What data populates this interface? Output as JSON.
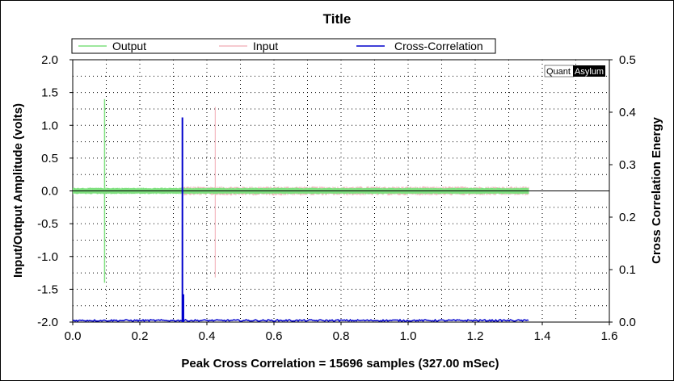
{
  "chart_data": {
    "type": "line",
    "title": "Title",
    "xlabel": "Peak Cross Correlation = 15696 samples  (327.00 mSec)",
    "ylabel": "Input/Output Amplitude (volts)",
    "y2label": "Cross Correlation Energy",
    "xlim": [
      0.0,
      1.6
    ],
    "ylim": [
      -2.0,
      2.0
    ],
    "y2lim": [
      0.0,
      0.5
    ],
    "x_ticks": [
      "0.0",
      "0.2",
      "0.4",
      "0.6",
      "0.8",
      "1.0",
      "1.2",
      "1.4",
      "1.6"
    ],
    "y_ticks": [
      "2.0",
      "1.5",
      "1.0",
      "0.5",
      "0.0",
      "-0.5",
      "-1.0",
      "-1.5",
      "-2.0"
    ],
    "y2_ticks": [
      "0.5",
      "0.4",
      "0.3",
      "0.2",
      "0.1",
      "0.0"
    ],
    "grid": true,
    "legend_position": "top",
    "watermark": {
      "part1": "Quant",
      "part2": "Asylum"
    },
    "series": [
      {
        "name": "Output",
        "color": "#7fe07f",
        "axis": "left",
        "noise_band": [
          -0.05,
          0.05
        ],
        "x_range": [
          0.0,
          1.36
        ],
        "spike": {
          "x": 0.095,
          "ymin": -1.4,
          "ymax": 1.4
        }
      },
      {
        "name": "Input",
        "color": "#f4b8c0",
        "axis": "left",
        "noise_band": [
          -0.07,
          0.07
        ],
        "x_range": [
          0.33,
          1.36
        ],
        "spike": {
          "x": 0.425,
          "ymin": -1.32,
          "ymax": 1.28
        }
      },
      {
        "name": "Cross-Correlation",
        "color": "#0000cc",
        "axis": "right",
        "baseline": 0.0,
        "x_range": [
          0.0,
          1.36
        ],
        "peak": {
          "x": 0.327,
          "y": 0.39
        },
        "secondary": {
          "x": 0.33,
          "y": 0.053
        }
      }
    ]
  }
}
